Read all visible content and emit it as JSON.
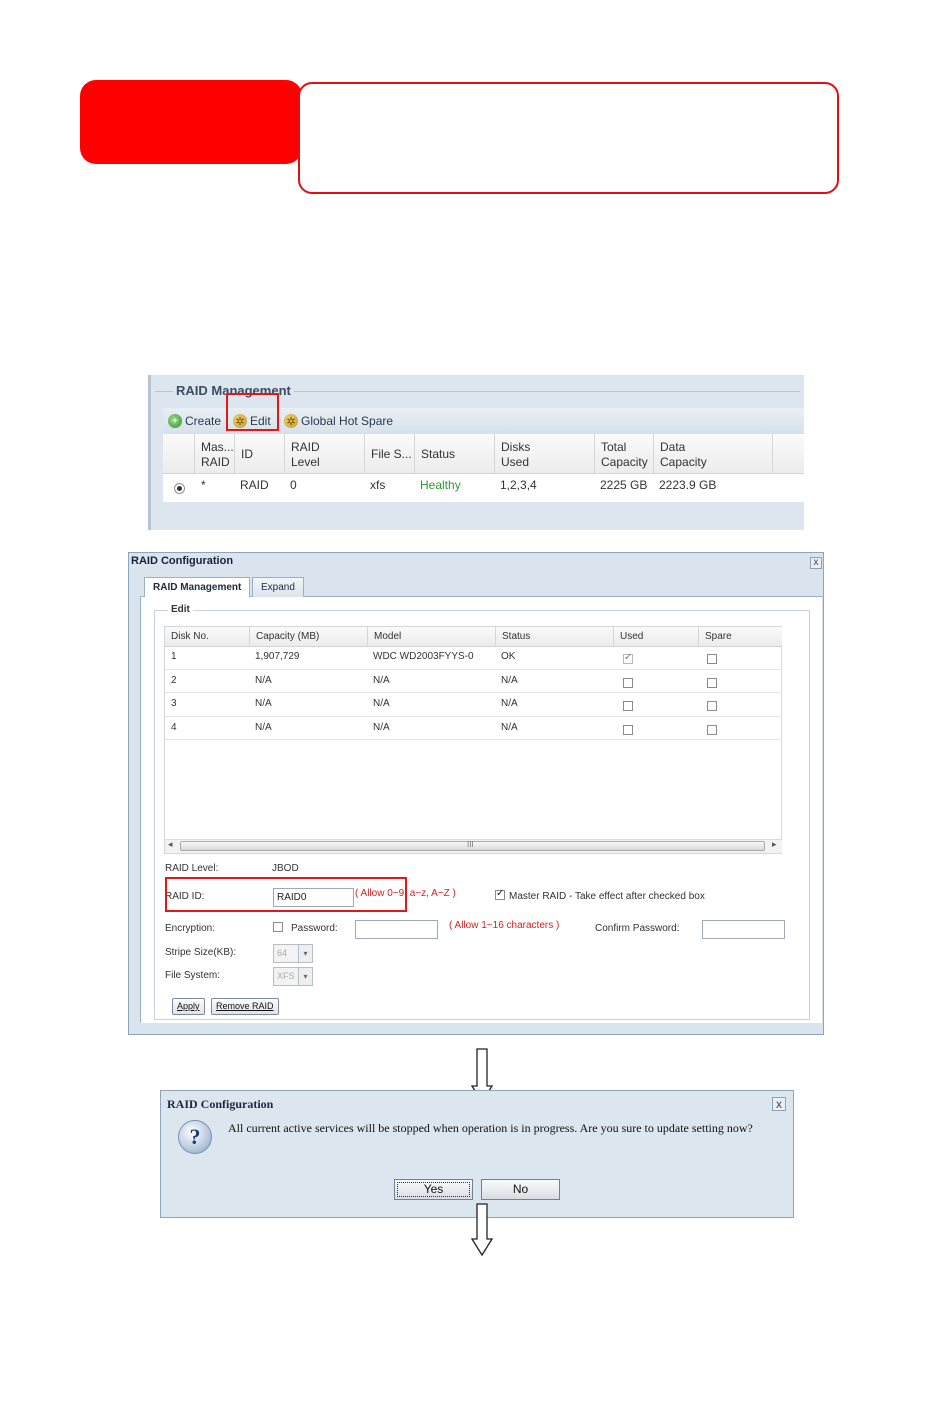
{
  "header": {
    "tab_text": "",
    "box_text": ""
  },
  "panel1": {
    "title": "RAID Management",
    "toolbar": {
      "create": "Create",
      "edit": "Edit",
      "hot_spare": "Global Hot Spare"
    },
    "columns": [
      {
        "line1": "Mas...",
        "line2": "RAID"
      },
      {
        "line1": "ID",
        "line2": ""
      },
      {
        "line1": "RAID",
        "line2": "Level"
      },
      {
        "line1": "File S...",
        "line2": ""
      },
      {
        "line1": "Status",
        "line2": ""
      },
      {
        "line1": "Disks",
        "line2": "Used"
      },
      {
        "line1": "Total",
        "line2": "Capacity"
      },
      {
        "line1": "Data",
        "line2": "Capacity"
      }
    ],
    "row": {
      "master": "*",
      "id": "RAID",
      "level": "0",
      "fs": "xfs",
      "status": "Healthy",
      "disks": "1,2,3,4",
      "total": "2225 GB",
      "data": "2223.9 GB"
    },
    "status_color": "#2e9a2e"
  },
  "config_window": {
    "title": "RAID Configuration",
    "close": "x",
    "tabs": [
      "RAID Management",
      "Expand"
    ],
    "legend": "Edit",
    "columns": [
      "Disk No.",
      "Capacity (MB)",
      "Model",
      "Status",
      "Used",
      "Spare"
    ],
    "rows": [
      {
        "disk": "1",
        "capacity": "1,907,729",
        "model": "WDC WD2003FYYS-0",
        "status": "OK"
      },
      {
        "disk": "2",
        "capacity": "N/A",
        "model": "N/A",
        "status": "N/A"
      },
      {
        "disk": "3",
        "capacity": "N/A",
        "model": "N/A",
        "status": "N/A"
      },
      {
        "disk": "4",
        "capacity": "N/A",
        "model": "N/A",
        "status": "N/A"
      }
    ],
    "scroll_grip": "III",
    "scroll_left": "◂",
    "scroll_right": "▸",
    "raid_level_label": "RAID Level:",
    "raid_level_value": "JBOD",
    "raid_id_label": "RAID ID:",
    "raid_id_value": "RAID0",
    "raid_id_hint": "( Allow 0~9, a~z, A~Z )",
    "master_raid_label": "Master RAID - Take effect after checked box",
    "encryption_label": "Encryption:",
    "password_label": "Password:",
    "password_hint": "( Allow 1~16 characters )",
    "confirm_password_label": "Confirm Password:",
    "stripe_label": "Stripe Size(KB):",
    "stripe_value": "64",
    "fs_label": "File System:",
    "fs_value": "XFS",
    "apply_button": "Apply",
    "remove_button": "Remove RAID"
  },
  "confirm_dialog": {
    "title": "RAID Configuration",
    "close": "x",
    "icon": "?",
    "message": "All current active services will be stopped when operation is in progress. Are you sure to update setting now?",
    "yes": "Yes",
    "no": "No"
  },
  "colors": {
    "highlight": "#e01818",
    "header_red": "#ff0000",
    "hint_red": "#d42020"
  }
}
